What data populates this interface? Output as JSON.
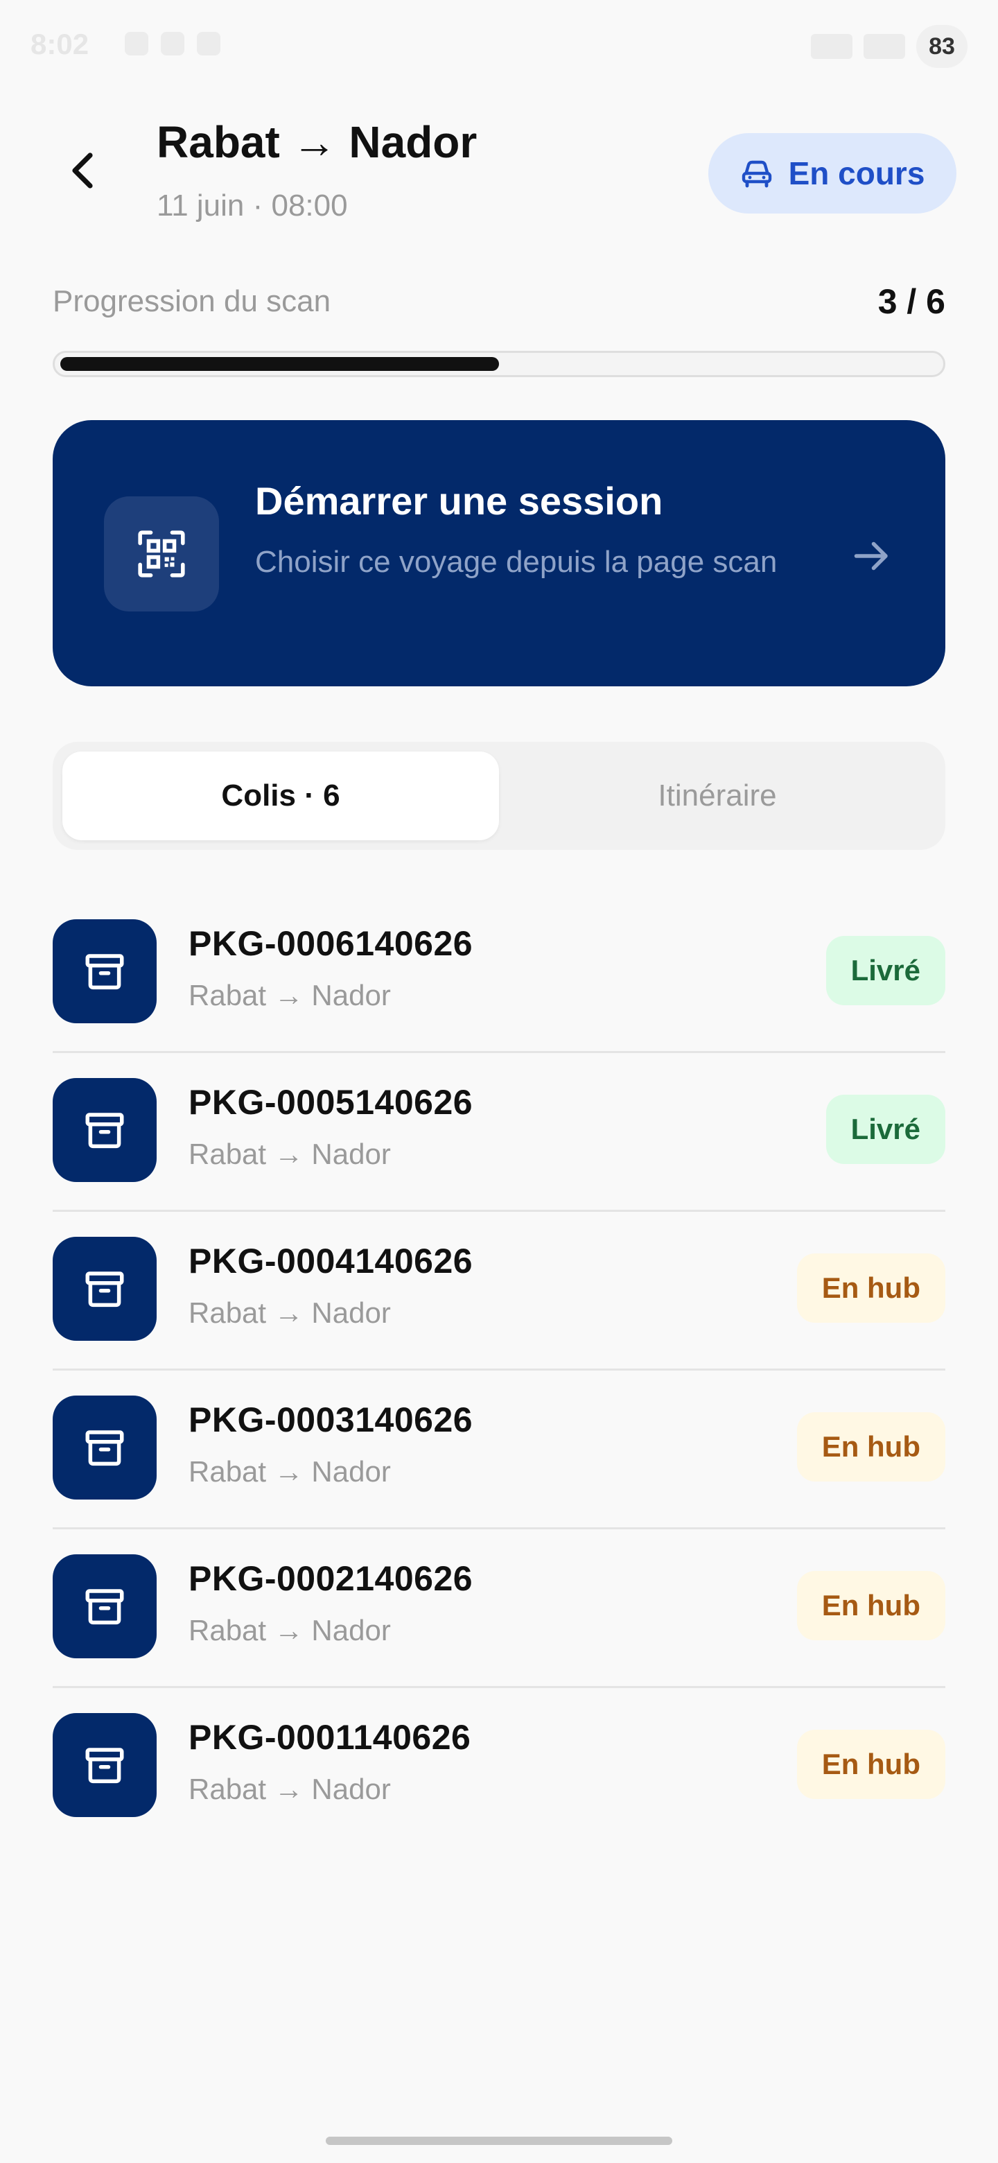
{
  "status_bar": {
    "time": "8:02",
    "battery": "83"
  },
  "header": {
    "title": "Rabat → Nador",
    "subtitle": "11 juin · 08:00",
    "status_label": "En cours"
  },
  "progress": {
    "label": "Progression du scan",
    "count_text": "3 / 6",
    "scanned": 3,
    "total": 6,
    "fraction": 0.5
  },
  "session_card": {
    "title": "Démarrer une session",
    "subtitle": "Choisir ce voyage depuis la page scan"
  },
  "tabs": [
    {
      "label": "Colis · 6",
      "active": true
    },
    {
      "label": "Itinéraire",
      "active": false
    }
  ],
  "packages": [
    {
      "id": "PKG-0006140626",
      "route": "Rabat → Nador",
      "status": "Livré",
      "status_kind": "delivered"
    },
    {
      "id": "PKG-0005140626",
      "route": "Rabat → Nador",
      "status": "Livré",
      "status_kind": "delivered"
    },
    {
      "id": "PKG-0004140626",
      "route": "Rabat → Nador",
      "status": "En hub",
      "status_kind": "hub"
    },
    {
      "id": "PKG-0003140626",
      "route": "Rabat → Nador",
      "status": "En hub",
      "status_kind": "hub"
    },
    {
      "id": "PKG-0002140626",
      "route": "Rabat → Nador",
      "status": "En hub",
      "status_kind": "hub"
    },
    {
      "id": "PKG-0001140626",
      "route": "Rabat → Nador",
      "status": "En hub",
      "status_kind": "hub"
    }
  ],
  "colors": {
    "primary_navy": "#03296a",
    "accent_blue": "#1f4fc7",
    "delivered_bg": "#dcfbe6",
    "delivered_text": "#1b6a3a",
    "hub_bg": "#fff8e4",
    "hub_text": "#a65a13"
  },
  "icons": {
    "back": "chevron-left-icon",
    "status": "car-icon",
    "session": "qr-code-icon",
    "session_action": "arrow-right-icon",
    "package": "archive-box-icon"
  }
}
